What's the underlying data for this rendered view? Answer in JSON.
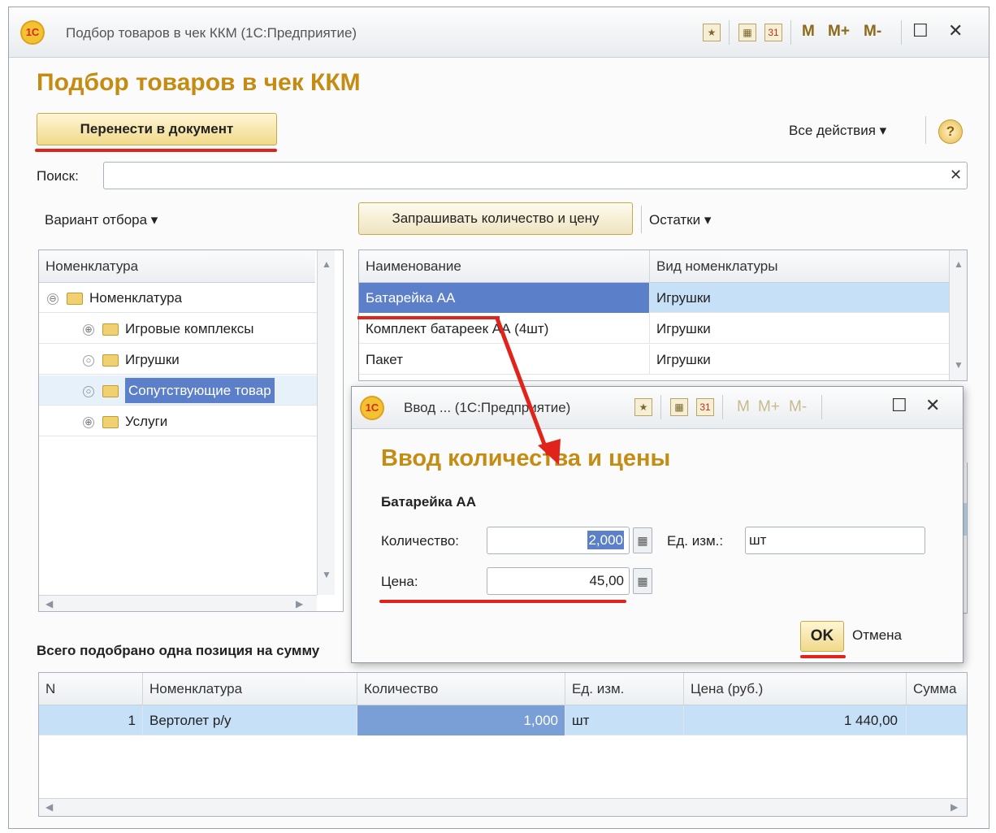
{
  "window": {
    "title": "Подбор товаров в чек ККМ  (1С:Предприятие)",
    "m_labels": [
      "M",
      "M+",
      "M-"
    ]
  },
  "form": {
    "heading": "Подбор товаров в чек ККМ",
    "transfer_button": "Перенести в документ",
    "all_actions": "Все действия",
    "help": "?",
    "search_label": "Поиск:",
    "search_value": "",
    "filter_variant": "Вариант отбора",
    "ask_qty_price": "Запрашивать количество и цену",
    "stock": "Остатки"
  },
  "tree": {
    "header": "Номенклатура",
    "items": [
      {
        "label": "Номенклатура",
        "toggle": "⊖",
        "level": 0
      },
      {
        "label": "Игровые комплексы",
        "toggle": "⊕",
        "level": 1
      },
      {
        "label": "Игрушки",
        "toggle": "○",
        "level": 1
      },
      {
        "label": "Сопутствующие товар",
        "toggle": "○",
        "level": 1
      },
      {
        "label": "Услуги",
        "toggle": "⊕",
        "level": 1
      }
    ]
  },
  "goods": {
    "columns": [
      "Наименование",
      "Вид номенклатуры"
    ],
    "rows": [
      [
        "Батарейка АА",
        "Игрушки"
      ],
      [
        "Комплект батареек АА (4шт)",
        "Игрушки"
      ],
      [
        "Пакет",
        "Игрушки"
      ]
    ]
  },
  "summary": "Всего подобрано одна позиция на сумму",
  "picked": {
    "columns": [
      "N",
      "Номенклатура",
      "Количество",
      "Ед. изм.",
      "Цена (руб.)",
      "Сумма"
    ],
    "rows": [
      [
        "1",
        "Вертолет р/у",
        "1,000",
        "шт",
        "1 440,00",
        ""
      ]
    ]
  },
  "dialog": {
    "title": "Ввод ...  (1С:Предприятие)",
    "heading": "Ввод количества и цены",
    "item": "Батарейка АА",
    "qty_label": "Количество:",
    "qty_value": "2,000",
    "unit_label": "Ед. изм.:",
    "unit_value": "шт",
    "price_label": "Цена:",
    "price_value": "45,00",
    "ok": "OK",
    "cancel": "Отмена"
  },
  "colors": {
    "accent": "#c58c14",
    "highlight": "#e0241c",
    "selection": "#5b7fc9"
  }
}
